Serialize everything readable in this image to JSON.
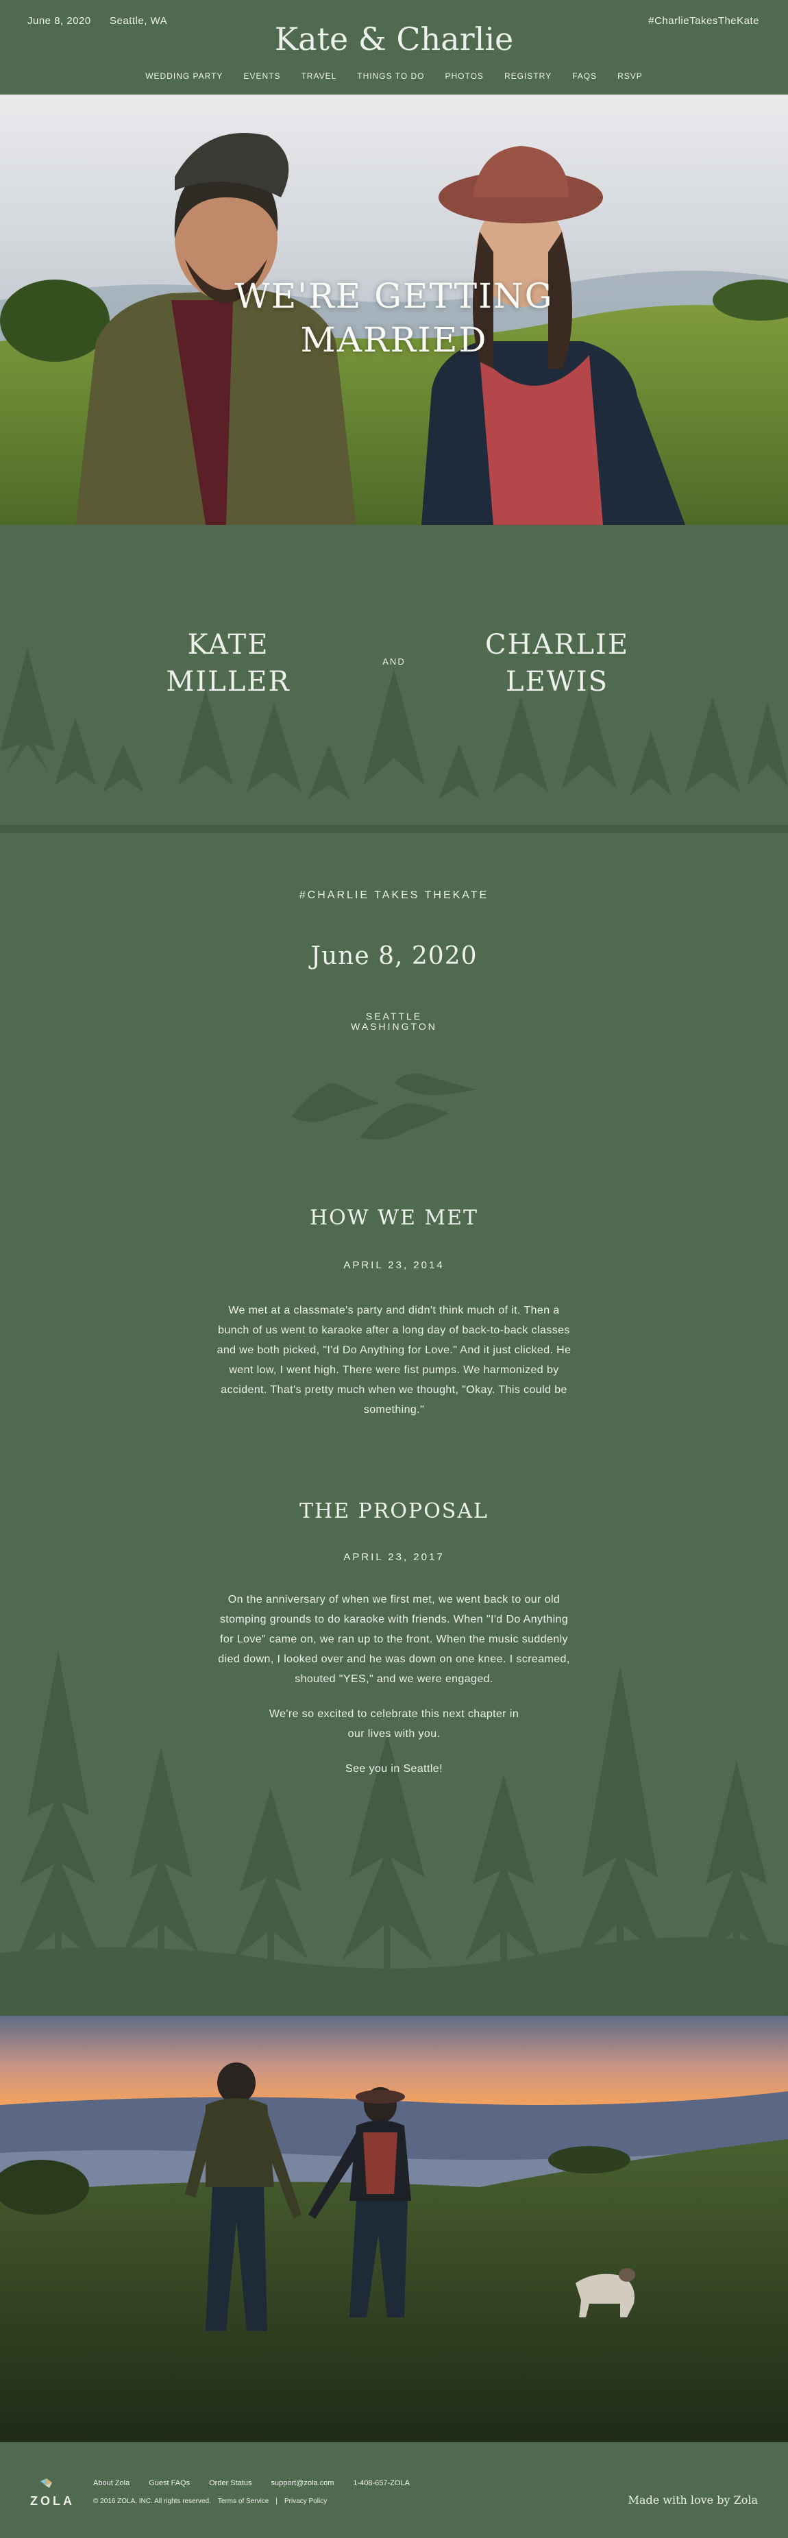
{
  "header": {
    "date": "June 8, 2020",
    "location": "Seattle, WA",
    "hashtag": "#CharlieTakesTheKate",
    "title": "Kate & Charlie",
    "nav": [
      "WEDDING PARTY",
      "EVENTS",
      "TRAVEL",
      "THINGS TO DO",
      "PHOTOS",
      "REGISTRY",
      "FAQS",
      "RSVP"
    ]
  },
  "hero": {
    "title_line1": "WE'RE GETTING",
    "title_line2": "MARRIED"
  },
  "couple": {
    "partner1_first": "KATE",
    "partner1_last": "MILLER",
    "connector": "AND",
    "partner2_first": "CHARLIE",
    "partner2_last": "LEWIS"
  },
  "info": {
    "hashtag": "#CHARLIE TAKES THEKATE",
    "date": "June 8, 2020",
    "city": "SEATTLE",
    "state": "WASHINGTON"
  },
  "how_we_met": {
    "title": "HOW WE MET",
    "date": "APRIL 23, 2014",
    "body": "We met at a classmate's party and didn't think much of it. Then a bunch of us went to karaoke after a long day of back-to-back classes and we both picked, \"I'd Do Anything for Love.\" And it just clicked. He went low, I went high. There were fist pumps. We harmonized by accident. That's pretty much when we thought, \"Okay. This could be something.\""
  },
  "proposal": {
    "title": "THE PROPOSAL",
    "date": "APRIL 23, 2017",
    "body": "On the anniversary of when we first met, we went back to our old stomping grounds to do karaoke with friends. When \"I'd Do Anything for Love\" came on, we ran up to the front. When the music suddenly died down, I looked over and he was down on one knee. I screamed, shouted \"YES,\" and we were engaged.",
    "closing1": "We're so excited to celebrate this next chapter in our lives with you.",
    "closing2": "See you in Seattle!"
  },
  "footer": {
    "brand": "ZOLA",
    "links": [
      "About Zola",
      "Guest FAQs",
      "Order Status",
      "support@zola.com",
      "1-408-657-ZOLA"
    ],
    "copyright": "© 2016 ZOLA, INC. All rights reserved.",
    "terms": "Terms of Service",
    "privacy": "Privacy Policy",
    "made_with": "Made with love by Zola"
  },
  "colors": {
    "background": "#4f6a4f",
    "tree_dark": "#3f5a40",
    "text": "#eef2ec"
  }
}
